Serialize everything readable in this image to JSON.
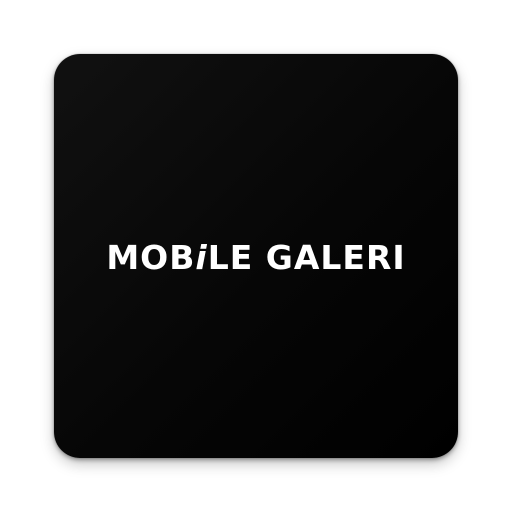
{
  "logo": {
    "before_i": "MOB",
    "stylized_i": "i",
    "after_i": "LE GALERI",
    "text_color": "#ffffff",
    "background_color": "#000000"
  }
}
